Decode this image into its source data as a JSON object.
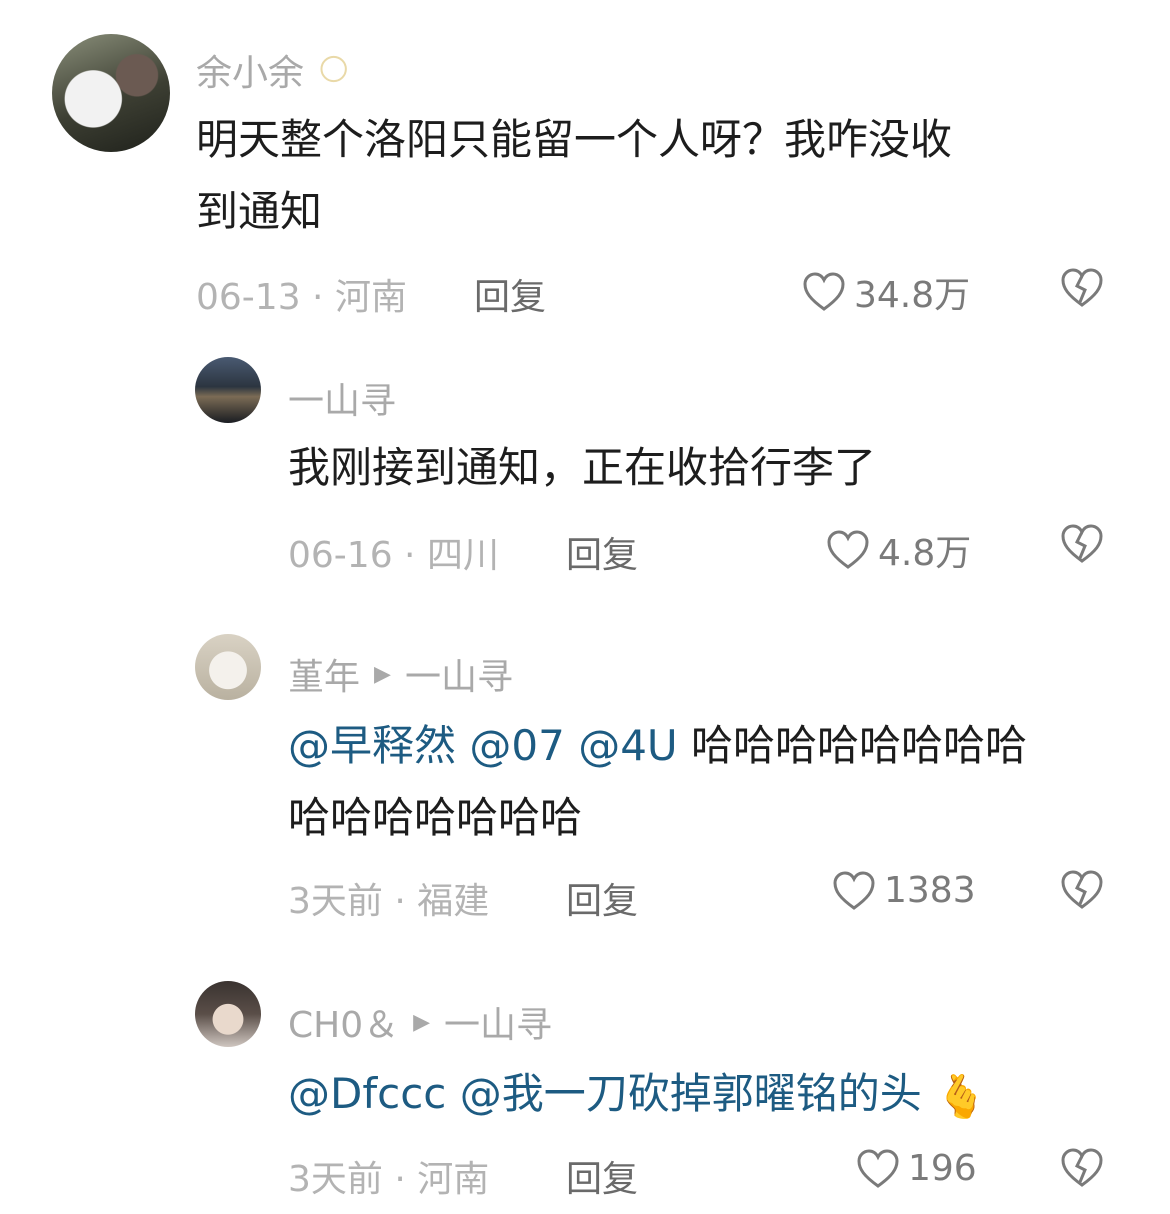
{
  "comments": [
    {
      "username": "余小余",
      "name_emoji": "🌕",
      "lines": [
        "明天整个洛阳只能留一个人呀？我咋没收",
        "到通知"
      ],
      "date_loc": "06-13 · 河南",
      "reply": "回复",
      "likes": "34.8万"
    },
    {
      "username": "一山寻",
      "lines": [
        "我刚接到通知，正在收拾行李了"
      ],
      "date_loc": "06-16 · 四川",
      "reply": "回复",
      "likes": "4.8万"
    },
    {
      "username": "堇年",
      "reply_to": "一山寻",
      "mentions": [
        "@早释然",
        "@07",
        "@4U"
      ],
      "line1_rest": " 哈哈哈哈哈哈哈哈",
      "line2": "哈哈哈哈哈哈哈",
      "date_loc": "3天前 · 福建",
      "reply": "回复",
      "likes": "1383"
    },
    {
      "username": "CH0＆",
      "reply_to": "一山寻",
      "mentions": [
        "@Dfccc",
        "@我一刀砍掉郭曜铭的头"
      ],
      "sticker": "🫰",
      "date_loc": "3天前 · 河南",
      "reply": "回复",
      "likes": "196"
    }
  ],
  "icons": {
    "like": "heart-outline-icon",
    "dislike": "broken-heart-icon",
    "reply_arrow": "play-triangle-icon"
  },
  "colors": {
    "mention": "#1d5b82",
    "meta": "#b3b3b3",
    "text": "#1d1d1d"
  }
}
